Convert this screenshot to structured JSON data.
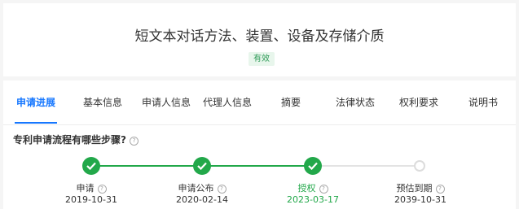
{
  "header": {
    "title": "短文本对话方法、装置、设备及存储介质",
    "status_badge": "有效"
  },
  "tabs": [
    {
      "label": "申请进展",
      "active": true
    },
    {
      "label": "基本信息"
    },
    {
      "label": "申请人信息"
    },
    {
      "label": "代理人信息"
    },
    {
      "label": "摘要"
    },
    {
      "label": "法律状态"
    },
    {
      "label": "权利要求"
    },
    {
      "label": "说明书"
    }
  ],
  "progress": {
    "question": "专利申请流程有哪些步骤?",
    "help_icon": "?",
    "steps": [
      {
        "label": "申请",
        "date": "2019-10-31",
        "done": true
      },
      {
        "label": "申请公布",
        "date": "2020-02-14",
        "done": true
      },
      {
        "label": "授权",
        "date": "2023-03-17",
        "done": true,
        "current": true
      },
      {
        "label": "预估到期",
        "date": "2039-10-31",
        "done": false
      }
    ]
  },
  "colors": {
    "accent": "#1677ff",
    "success": "#22a84a",
    "badge_bg": "#e8f6ec"
  }
}
